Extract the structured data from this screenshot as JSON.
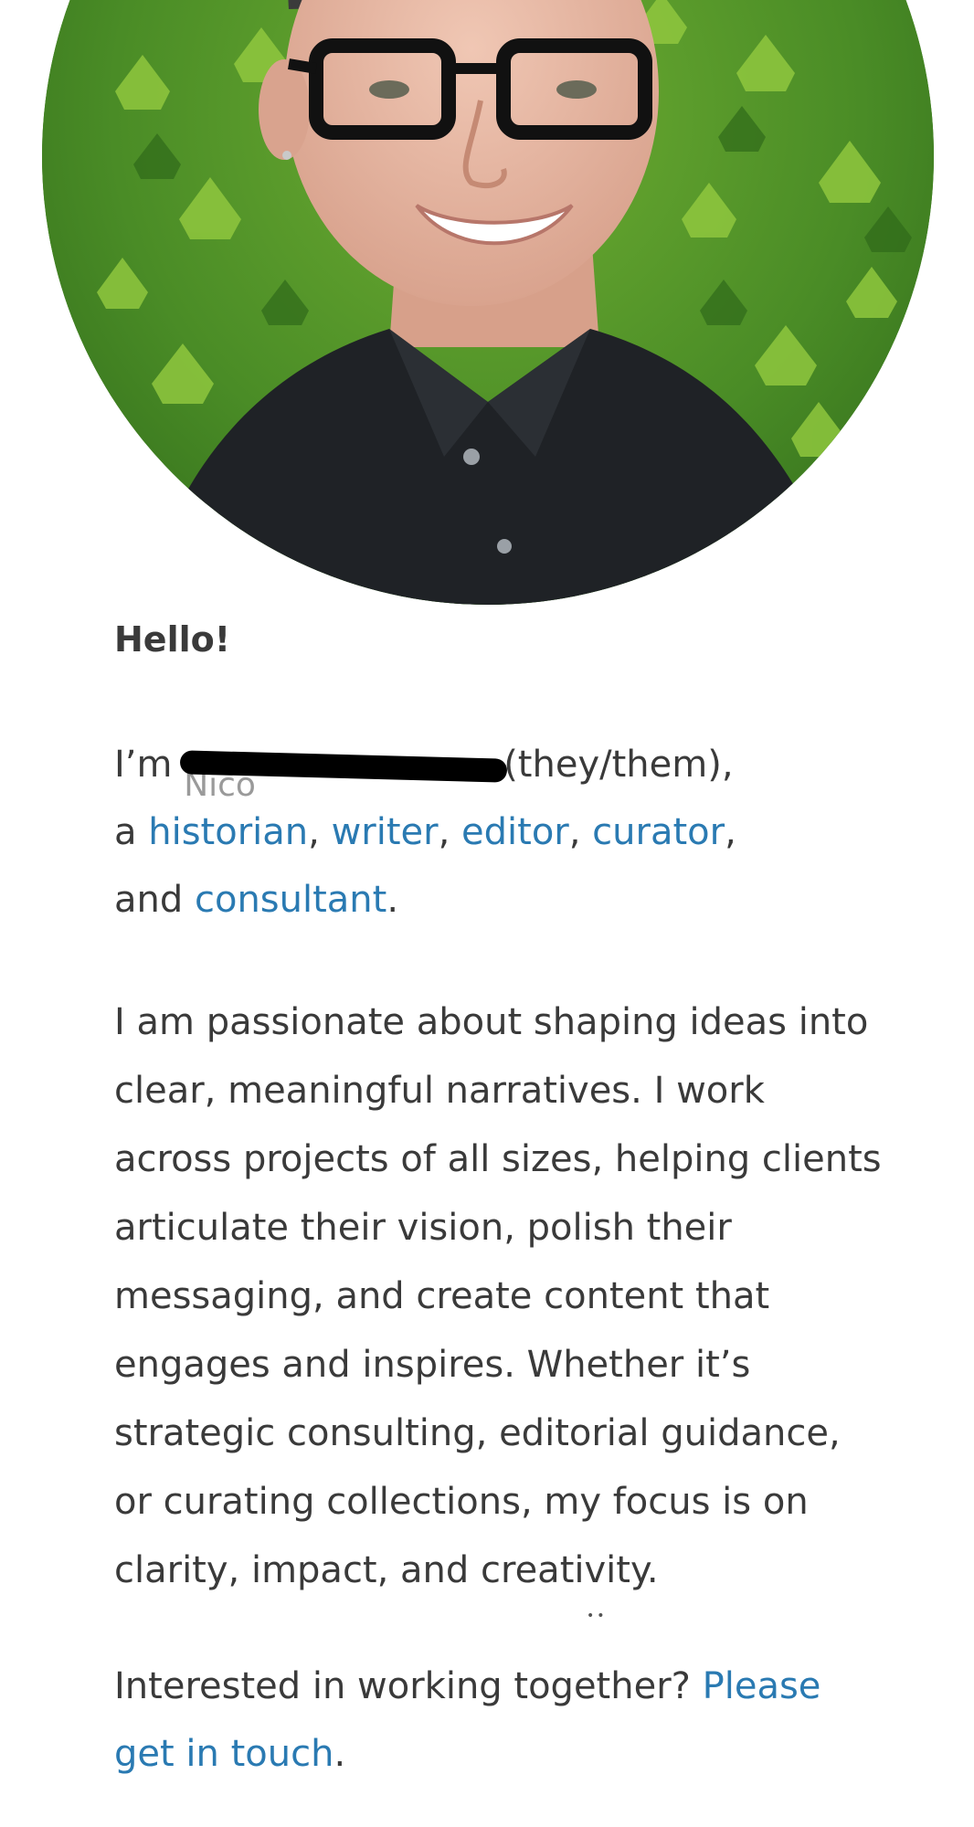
{
  "portrait": {
    "alt": "Portrait photo in front of green ivy leaves"
  },
  "greeting": "Hello!",
  "intro": {
    "prefix": "I’m",
    "redacted_name": "Nico",
    "pronouns": "(they/them),",
    "article": "a",
    "roles": [
      "historian",
      "writer",
      "editor",
      "curator"
    ],
    "sep": ",",
    "and": "and",
    "last_role": "consultant",
    "end": "."
  },
  "about": "I am passionate about shaping ideas into clear, meaningful narratives. I work across projects of all sizes, helping clients articulate their vision, polish their messaging, and create content that engages and inspires. Whether it’s strategic consulting, editorial guidance, or curating collections, my focus is on clarity, impact, and creativity.",
  "contact": {
    "prefix": "Interested in working together?",
    "link": "Please get in touch",
    "end": "."
  },
  "colors": {
    "link": "#2a7ab2",
    "text": "#3a3a3a",
    "leaf_dark": "#3d7a22",
    "leaf_light": "#8fc73e",
    "shirt": "#1f2226"
  }
}
